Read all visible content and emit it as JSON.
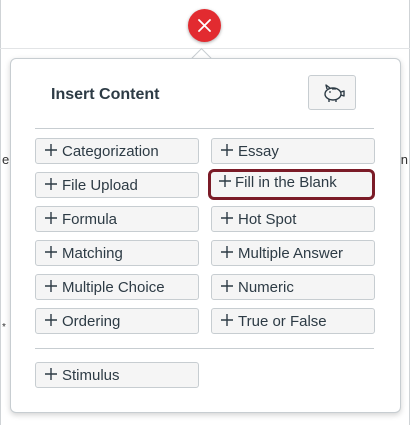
{
  "popover": {
    "title": "Insert Content",
    "icon_button": "piggy-bank-icon"
  },
  "close_button": {
    "icon": "close-icon"
  },
  "background": {
    "fragment_left": "e",
    "fragment_right": "n",
    "fragment_left2": "*"
  },
  "options": [
    {
      "label": "Categorization"
    },
    {
      "label": "Essay"
    },
    {
      "label": "File Upload"
    },
    {
      "label": "Fill in the Blank",
      "selected": true
    },
    {
      "label": "Formula"
    },
    {
      "label": "Hot Spot"
    },
    {
      "label": "Matching"
    },
    {
      "label": "Multiple Answer"
    },
    {
      "label": "Multiple Choice"
    },
    {
      "label": "Numeric"
    },
    {
      "label": "Ordering"
    },
    {
      "label": "True or False"
    }
  ],
  "stimulus": {
    "label": "Stimulus"
  },
  "colors": {
    "close": "#e22b30",
    "highlight": "#7b1b27",
    "text": "#2d3b45"
  }
}
